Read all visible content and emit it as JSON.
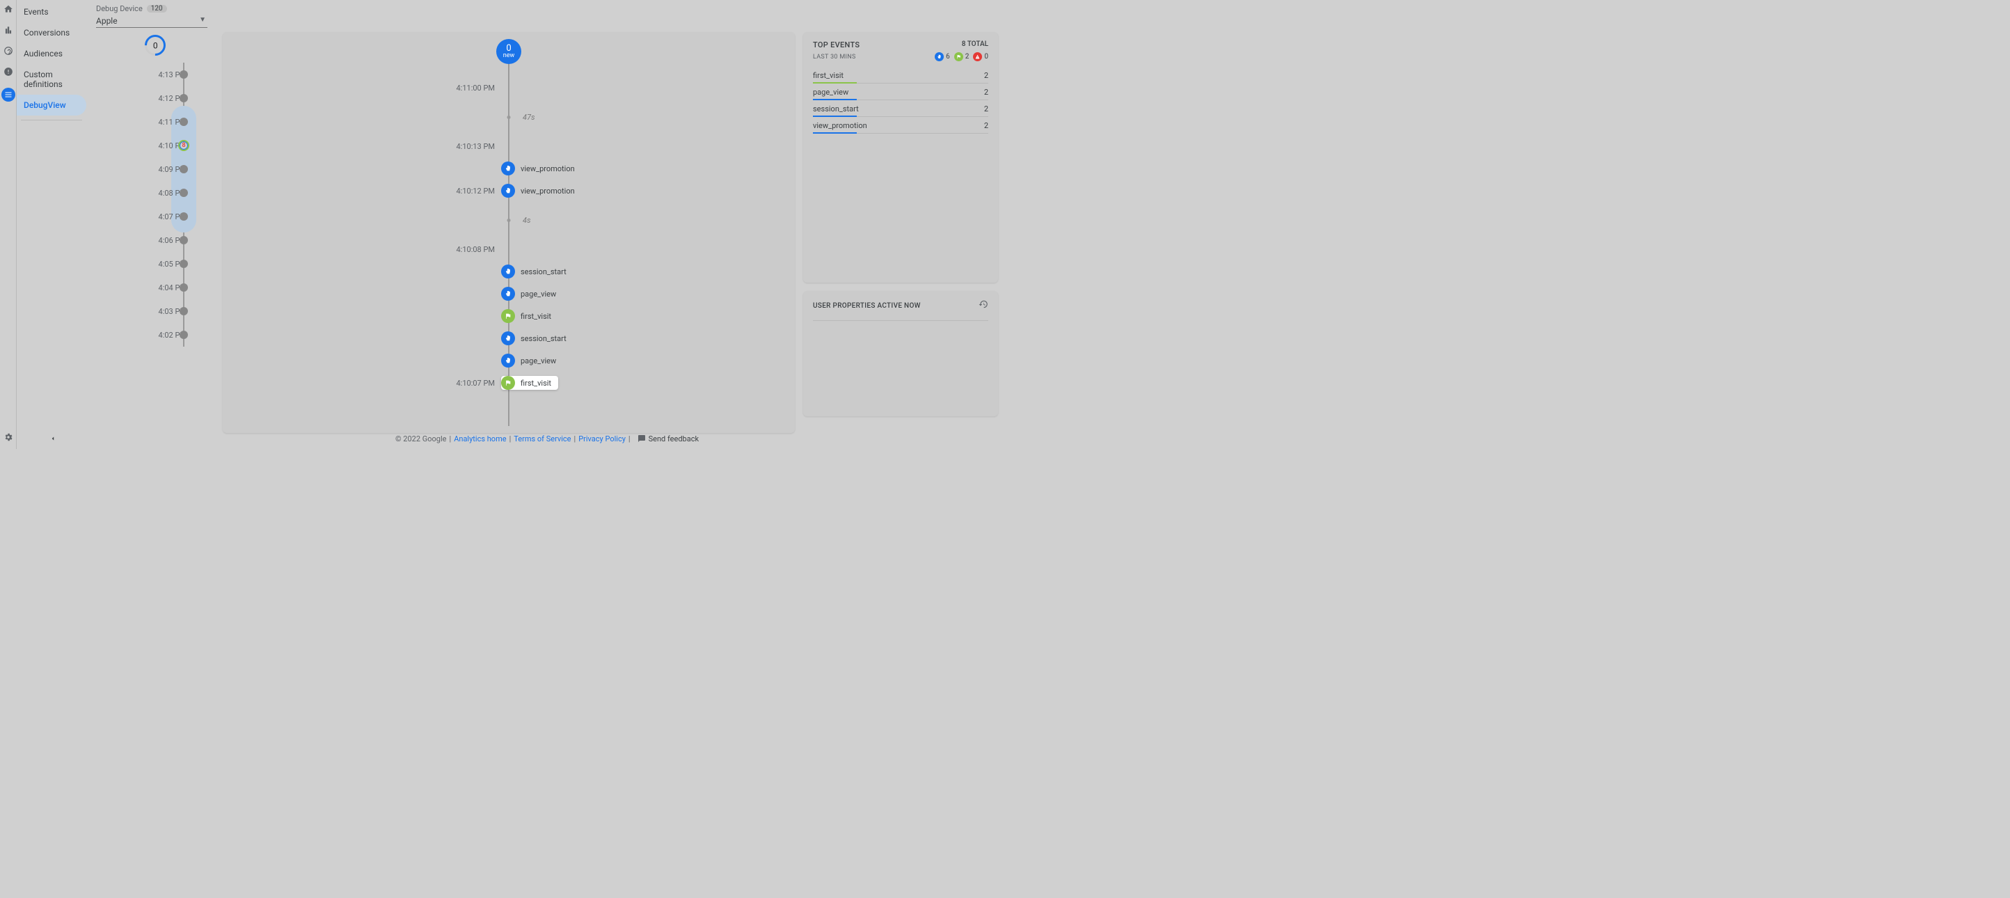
{
  "rail": {
    "icons": [
      "home",
      "reports",
      "explore",
      "advertising",
      "configure"
    ],
    "settings": "settings"
  },
  "nav": {
    "items": [
      "Events",
      "Conversions",
      "Audiences",
      "Custom definitions",
      "DebugView"
    ],
    "active_index": 4
  },
  "debug": {
    "label": "Debug Device",
    "device_count": "120",
    "selected_device": "Apple"
  },
  "minutes": {
    "bubble_count": "0",
    "highlight_start_index": 2,
    "highlight_end_index": 6,
    "rows": [
      {
        "time": "4:13 PM",
        "count": null
      },
      {
        "time": "4:12 PM",
        "count": null
      },
      {
        "time": "4:11 PM",
        "count": null
      },
      {
        "time": "4:10 PM",
        "count": "8"
      },
      {
        "time": "4:09 PM",
        "count": null
      },
      {
        "time": "4:08 PM",
        "count": null
      },
      {
        "time": "4:07 PM",
        "count": null
      },
      {
        "time": "4:06 PM",
        "count": null
      },
      {
        "time": "4:05 PM",
        "count": null
      },
      {
        "time": "4:04 PM",
        "count": null
      },
      {
        "time": "4:03 PM",
        "count": null
      },
      {
        "time": "4:02 PM",
        "count": null
      }
    ]
  },
  "stream": {
    "new_count": "0",
    "new_label": "new",
    "rows": [
      {
        "type": "time",
        "time": "4:11:00 PM"
      },
      {
        "type": "gap",
        "label": "47s"
      },
      {
        "type": "time",
        "time": "4:10:13 PM"
      },
      {
        "type": "event",
        "icon": "blue",
        "name": "view_promotion"
      },
      {
        "type": "event",
        "icon": "blue",
        "name": "view_promotion",
        "time": "4:10:12 PM"
      },
      {
        "type": "gap",
        "label": "4s"
      },
      {
        "type": "time",
        "time": "4:10:08 PM"
      },
      {
        "type": "event",
        "icon": "blue",
        "name": "session_start"
      },
      {
        "type": "event",
        "icon": "blue",
        "name": "page_view"
      },
      {
        "type": "event",
        "icon": "green",
        "name": "first_visit"
      },
      {
        "type": "event",
        "icon": "blue",
        "name": "session_start"
      },
      {
        "type": "event",
        "icon": "blue",
        "name": "page_view"
      },
      {
        "type": "event",
        "icon": "green",
        "name": "first_visit",
        "selected": true,
        "time": "4:10:07 PM"
      }
    ]
  },
  "top_events": {
    "title": "TOP EVENTS",
    "total": "8 TOTAL",
    "subtitle": "LAST 30 MINS",
    "chips": [
      {
        "color": "blue",
        "count": "6"
      },
      {
        "color": "green",
        "count": "2"
      },
      {
        "color": "red",
        "count": "0"
      }
    ],
    "rows": [
      {
        "name": "first_visit",
        "count": "2",
        "bar": 25,
        "color": "green"
      },
      {
        "name": "page_view",
        "count": "2",
        "bar": 25,
        "color": "blue"
      },
      {
        "name": "session_start",
        "count": "2",
        "bar": 25,
        "color": "blue"
      },
      {
        "name": "view_promotion",
        "count": "2",
        "bar": 25,
        "color": "blue"
      }
    ]
  },
  "user_props": {
    "title": "USER PROPERTIES ACTIVE NOW"
  },
  "footer": {
    "copyright": "© 2022 Google",
    "links": [
      "Analytics home",
      "Terms of Service",
      "Privacy Policy"
    ],
    "feedback": "Send feedback"
  }
}
